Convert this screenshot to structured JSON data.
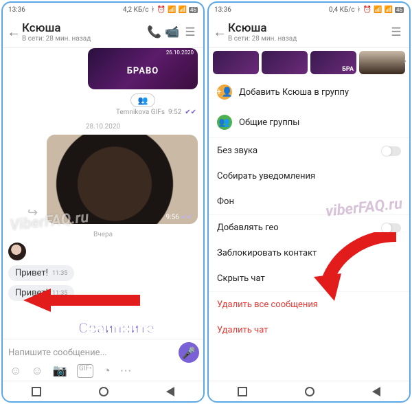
{
  "left": {
    "status": {
      "time": "13:36",
      "net": "4,2 КБ/с",
      "badge": "46"
    },
    "header": {
      "name": "Ксюша",
      "sub": "В сети: 28 мин. назад"
    },
    "gif": {
      "date": "26.10.2020",
      "text": "БРАВО",
      "source": "Temnikova GIFs",
      "time": "9:52"
    },
    "date1": "28.10.2020",
    "photo_time": "9:56",
    "date2": "Вчера",
    "msg1": {
      "text": "Привет!",
      "time": "11:35"
    },
    "msg2": {
      "text": "Привет!",
      "time": "11:35"
    },
    "input_placeholder": "Напишите сообщение...",
    "watermark": "ViberFAQ.ru"
  },
  "right": {
    "status": {
      "time": "13:36",
      "net": "0,4 КБ/с",
      "badge": "46"
    },
    "header": {
      "name": "Ксюша",
      "sub": "В сети: 28 мин. назад"
    },
    "thumb_text": "БРА",
    "menu": {
      "add_group": "Добавить Ксюша в группу",
      "common_groups": "Общие группы",
      "mute": "Без звука",
      "collect_notif": "Собирать уведомления",
      "background": "Фон",
      "add_geo": "Добавлять гео",
      "block": "Заблокировать контакт",
      "hide": "Скрыть чат",
      "delete_msgs": "Удалить все сообщения",
      "delete_chat": "Удалить чат"
    },
    "watermark": "viberFAQ.ru"
  },
  "annotation": {
    "swipe": "Свайпните"
  }
}
